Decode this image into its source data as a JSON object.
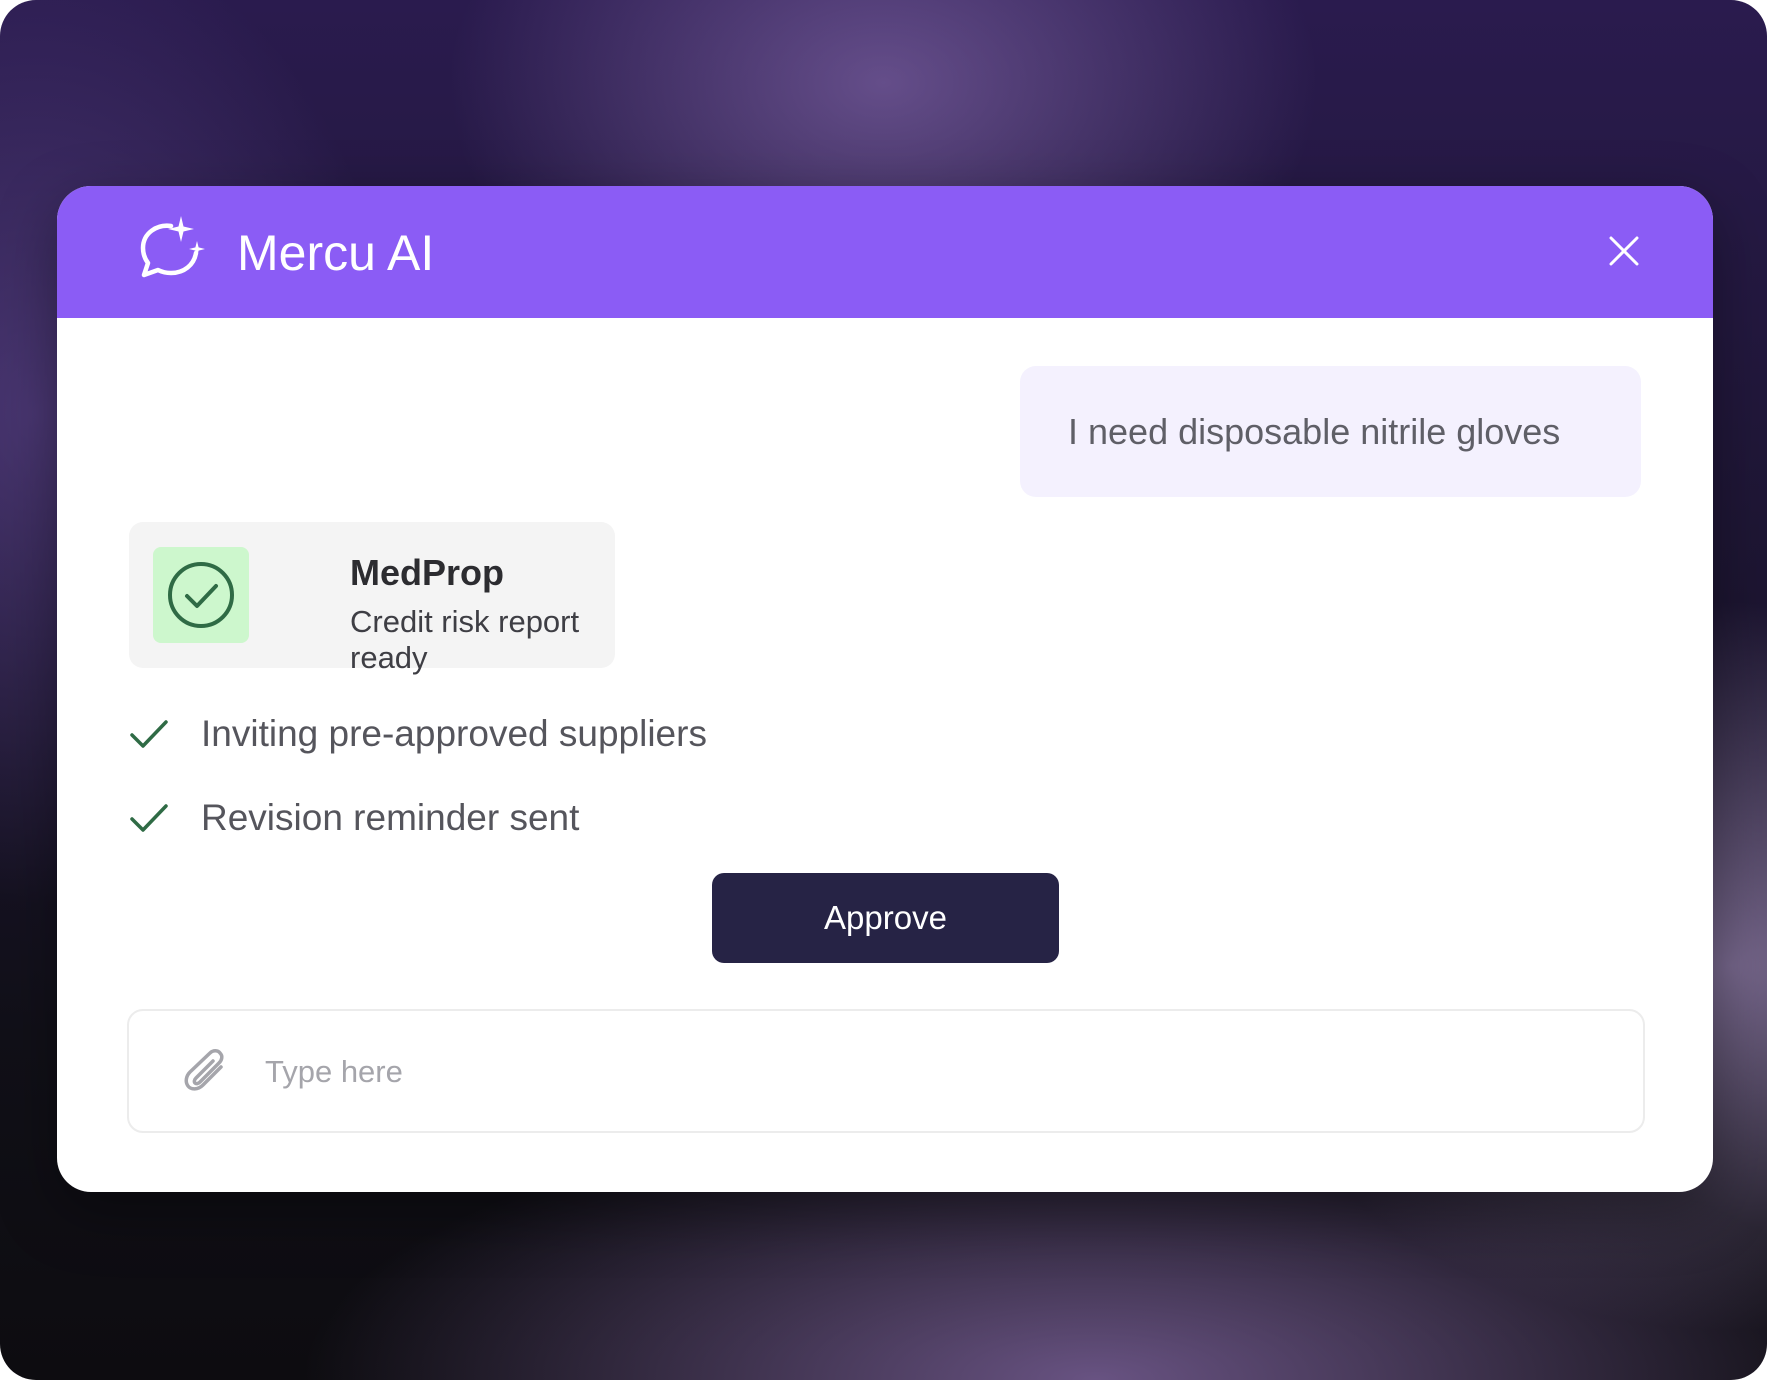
{
  "header": {
    "title": "Mercu AI",
    "logo_icon": "chat-sparkle-icon",
    "close_icon": "close-icon"
  },
  "messages": {
    "user_message": "I need disposable nitrile gloves"
  },
  "status_card": {
    "name": "MedProp",
    "subtitle": "Credit risk report ready",
    "icon": "check-circle-icon"
  },
  "steps": [
    {
      "label": "Inviting pre-approved suppliers",
      "icon": "checkmark-icon"
    },
    {
      "label": "Revision reminder sent",
      "icon": "checkmark-icon"
    }
  ],
  "actions": {
    "approve_label": "Approve"
  },
  "composer": {
    "placeholder": "Type here",
    "value": "",
    "attach_icon": "paperclip-icon"
  },
  "colors": {
    "header": "#8b5cf5",
    "user_bubble": "#f4f1fe",
    "badge_bg": "#cdf7cd",
    "check_green": "#2f6b45",
    "approve_button": "#262345"
  }
}
